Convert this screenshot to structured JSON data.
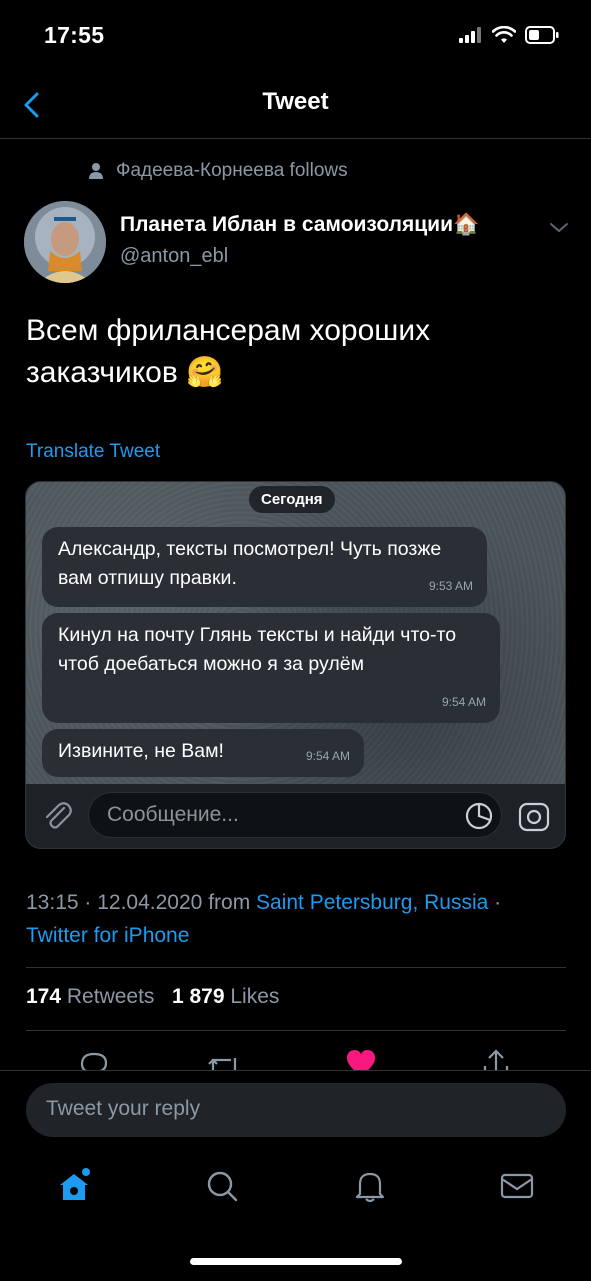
{
  "status": {
    "time": "17:55"
  },
  "header": {
    "title": "Tweet"
  },
  "social_context": "Фадеева-Корнеева follows",
  "author": {
    "name": "Планета Иблан в самоизоляции🏠",
    "handle": "@anton_ebl"
  },
  "tweet": {
    "text": "Всем фрилансерам хороших заказчиков 🤗",
    "translate_label": "Translate Tweet"
  },
  "media": {
    "date_pill": "Сегодня",
    "messages": [
      {
        "text": "Александр, тексты посмотрел! Чуть позже вам отпишу правки.",
        "time": "9:53 AM"
      },
      {
        "text": "Кинул на почту Глянь тексты и найди что-то чтоб  доебаться можно я за рулём",
        "time": "9:54 AM"
      },
      {
        "text": "Извините, не Вам!",
        "time": "9:54 AM"
      }
    ],
    "input_placeholder": "Сообщение..."
  },
  "meta": {
    "time": "13:15",
    "date": "12.04.2020",
    "from": "from",
    "location": "Saint Petersburg, Russia",
    "client": "Twitter for iPhone"
  },
  "stats": {
    "retweets_count": "174",
    "retweets_label": "Retweets",
    "likes_count": "1 879",
    "likes_label": "Likes"
  },
  "reply": {
    "placeholder": "Tweet your reply"
  },
  "colors": {
    "accent": "#1d9bf0",
    "like": "#f91880",
    "muted": "#8b98a5"
  },
  "icons": [
    "back-icon",
    "person-icon",
    "chevron-down-icon",
    "paperclip-icon",
    "sticker-icon",
    "camera-icon",
    "reply-icon",
    "retweet-icon",
    "heart-icon",
    "share-icon",
    "home-icon",
    "search-icon",
    "bell-icon",
    "mail-icon"
  ]
}
